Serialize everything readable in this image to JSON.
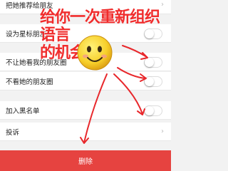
{
  "settings": {
    "recommend_to_friends": "把她推荐给朋友",
    "set_star_friend": "设为星标朋友",
    "hide_my_moments": "不让她看我的朋友圈",
    "hide_her_moments": "不看她的朋友圈",
    "add_to_blacklist": "加入黑名单",
    "report": "投诉",
    "delete_label": "删除"
  },
  "overlay": {
    "caption_line1": "给你一次重新组织语言",
    "caption_line2": "的机会",
    "caption_color": "#f02d2d",
    "emoji": "smiley-face",
    "arrow_color": "#e8272b"
  },
  "colors": {
    "delete_button": "#e64340",
    "background": "#f2f2f2"
  }
}
